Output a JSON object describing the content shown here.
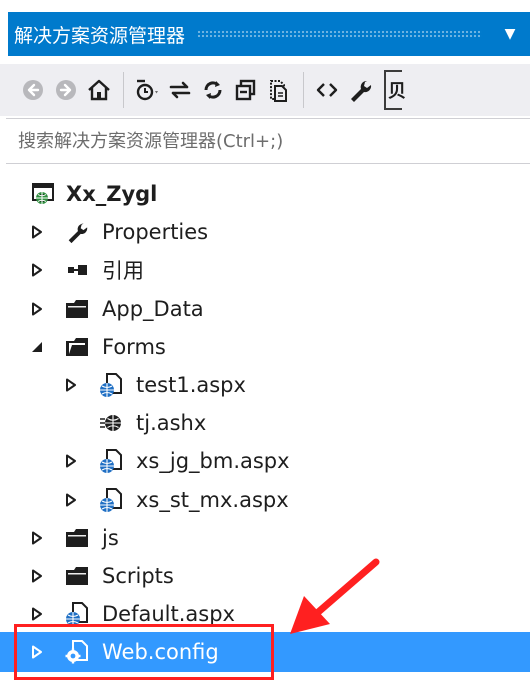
{
  "title_bar": {
    "title": "解决方案资源管理器",
    "dropdown_glyph": "▼"
  },
  "toolbar": {
    "buttons": [
      {
        "name": "back-icon"
      },
      {
        "name": "forward-icon"
      },
      {
        "name": "home-icon"
      },
      {
        "name": "history-icon"
      },
      {
        "name": "sync-icon"
      },
      {
        "name": "refresh-icon"
      },
      {
        "name": "collapse-all-icon"
      },
      {
        "name": "show-all-files-icon"
      },
      {
        "name": "view-code-icon"
      },
      {
        "name": "properties-wrench-icon"
      }
    ],
    "last_button_glyph": "贝"
  },
  "search": {
    "placeholder": "搜索解决方案资源管理器(Ctrl+;)",
    "value": ""
  },
  "tree": {
    "root": {
      "label": "Xx_Zygl",
      "icon": "web-project-icon"
    },
    "items": [
      {
        "label": "Properties",
        "icon": "wrench-icon",
        "expander": "collapsed",
        "level": 1
      },
      {
        "label": "引用",
        "icon": "references-icon",
        "expander": "collapsed",
        "level": 1
      },
      {
        "label": "App_Data",
        "icon": "folder-icon",
        "expander": "collapsed",
        "level": 1
      },
      {
        "label": "Forms",
        "icon": "folder-open-icon",
        "expander": "expanded",
        "level": 1
      },
      {
        "label": "test1.aspx",
        "icon": "aspx-file-icon",
        "expander": "collapsed",
        "level": 2
      },
      {
        "label": "tj.ashx",
        "icon": "ashx-file-icon",
        "expander": "none",
        "level": 2
      },
      {
        "label": "xs_jg_bm.aspx",
        "icon": "aspx-file-icon",
        "expander": "collapsed",
        "level": 2
      },
      {
        "label": "xs_st_mx.aspx",
        "icon": "aspx-file-icon",
        "expander": "collapsed",
        "level": 2
      },
      {
        "label": "js",
        "icon": "folder-icon",
        "expander": "collapsed",
        "level": 1
      },
      {
        "label": "Scripts",
        "icon": "folder-icon",
        "expander": "collapsed",
        "level": 1
      },
      {
        "label": "Default.aspx",
        "icon": "aspx-file-icon",
        "expander": "collapsed",
        "level": 1
      },
      {
        "label": "Web.config",
        "icon": "config-file-icon",
        "expander": "collapsed",
        "level": 1,
        "selected": true
      }
    ]
  },
  "colors": {
    "accent": "#007acc",
    "selection": "#3399ff",
    "annotation": "#ff2020"
  }
}
